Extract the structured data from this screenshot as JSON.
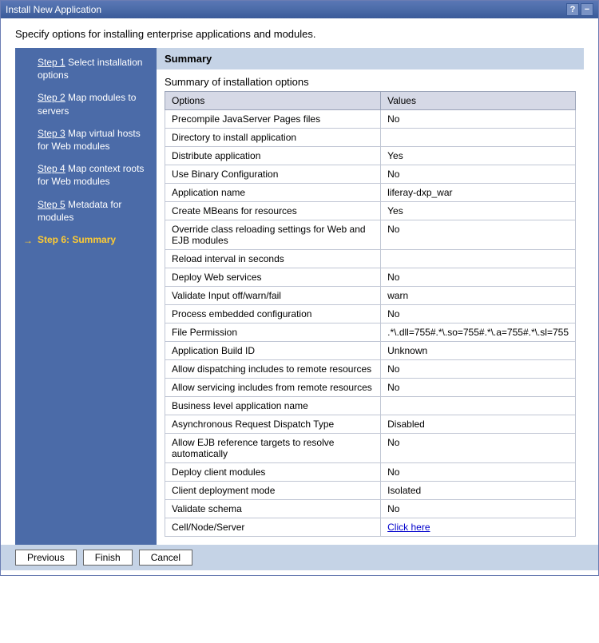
{
  "window": {
    "title": "Install New Application"
  },
  "intro": "Specify options for installing enterprise applications and modules.",
  "sidebar": {
    "steps": [
      {
        "label": "Step 1",
        "rest": "  Select installation options"
      },
      {
        "label": "Step 2",
        "rest": "  Map modules to servers"
      },
      {
        "label": "Step 3",
        "rest": "  Map virtual hosts for Web modules"
      },
      {
        "label": "Step 4",
        "rest": "  Map context roots for Web modules"
      },
      {
        "label": "Step 5",
        "rest": "  Metadata for modules"
      }
    ],
    "current": "Step 6: Summary"
  },
  "main": {
    "header": "Summary",
    "subtitle": "Summary of installation options",
    "table": {
      "head": {
        "col1": "Options",
        "col2": "Values"
      },
      "rows": [
        {
          "opt": "Precompile JavaServer Pages files",
          "val": "No"
        },
        {
          "opt": "Directory to install application",
          "val": ""
        },
        {
          "opt": "Distribute application",
          "val": "Yes"
        },
        {
          "opt": "Use Binary Configuration",
          "val": "No"
        },
        {
          "opt": "Application name",
          "val": "liferay-dxp_war"
        },
        {
          "opt": "Create MBeans for resources",
          "val": "Yes"
        },
        {
          "opt": "Override class reloading settings for Web and EJB modules",
          "val": "No"
        },
        {
          "opt": "Reload interval in seconds",
          "val": ""
        },
        {
          "opt": "Deploy Web services",
          "val": "No"
        },
        {
          "opt": "Validate Input off/warn/fail",
          "val": "warn"
        },
        {
          "opt": "Process embedded configuration",
          "val": "No"
        },
        {
          "opt": "File Permission",
          "val": ".*\\.dll=755#.*\\.so=755#.*\\.a=755#.*\\.sl=755"
        },
        {
          "opt": "Application Build ID",
          "val": "Unknown"
        },
        {
          "opt": "Allow dispatching includes to remote resources",
          "val": "No"
        },
        {
          "opt": "Allow servicing includes from remote resources",
          "val": "No"
        },
        {
          "opt": "Business level application name",
          "val": ""
        },
        {
          "opt": "Asynchronous Request Dispatch Type",
          "val": "Disabled"
        },
        {
          "opt": "Allow EJB reference targets to resolve automatically",
          "val": "No"
        },
        {
          "opt": "Deploy client modules",
          "val": "No"
        },
        {
          "opt": "Client deployment mode",
          "val": "Isolated"
        },
        {
          "opt": "Validate schema",
          "val": "No"
        },
        {
          "opt": "Cell/Node/Server",
          "val": "Click here",
          "link": true
        }
      ]
    }
  },
  "buttons": {
    "previous": "Previous",
    "finish": "Finish",
    "cancel": "Cancel"
  }
}
